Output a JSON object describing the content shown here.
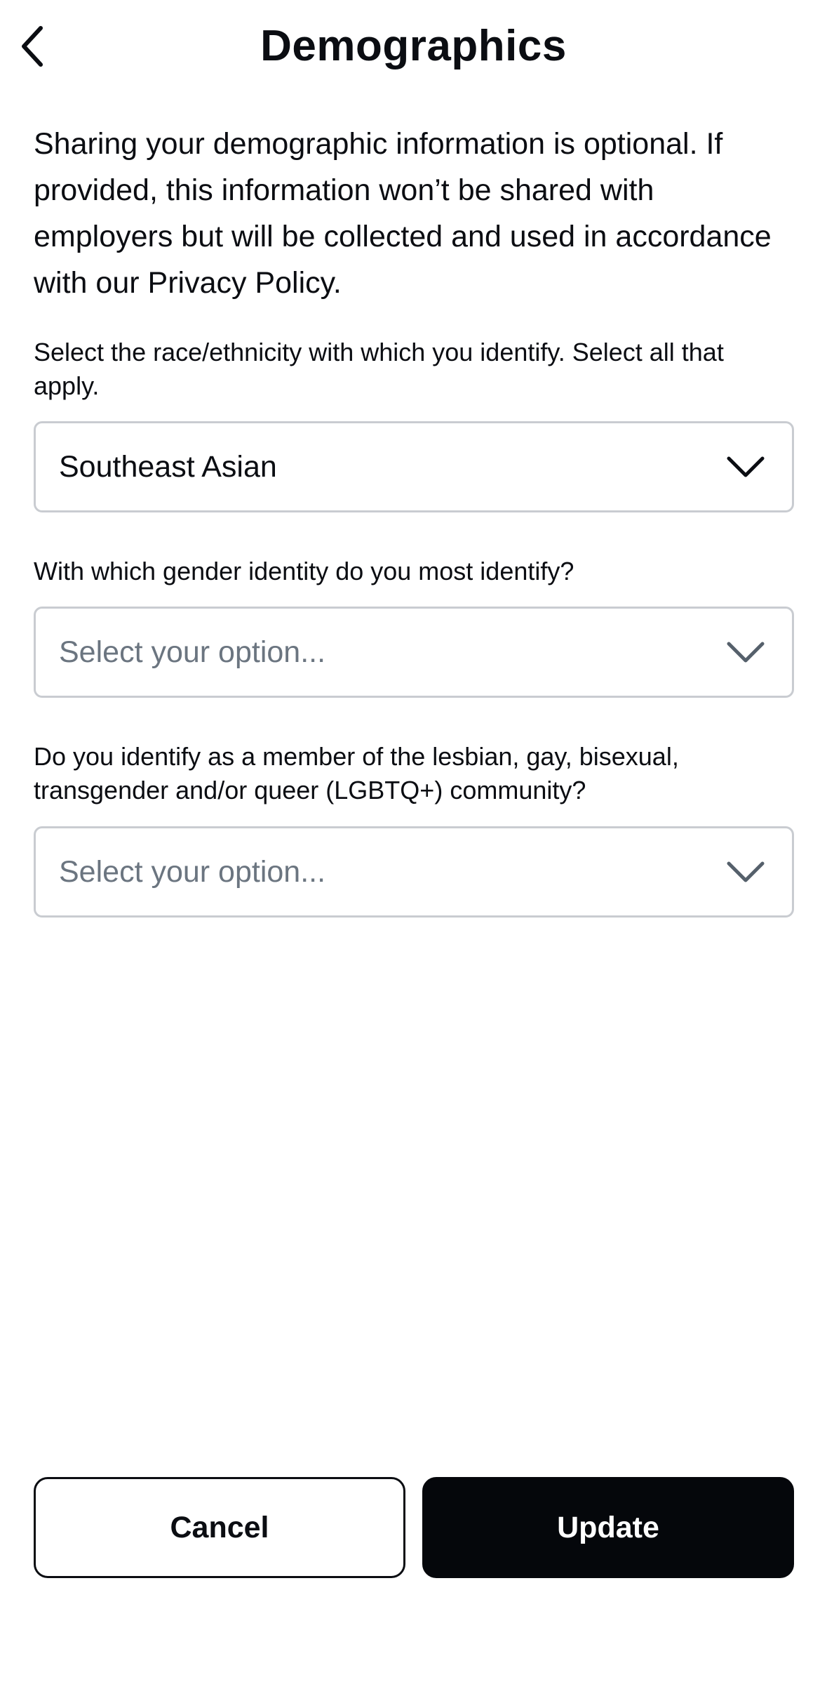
{
  "header": {
    "title": "Demographics",
    "back_icon": "chevron-left-icon"
  },
  "intro": {
    "text": "Sharing your demographic information is optional. If provided, this information won’t be shared with employers but will be collected and used in accordance with our Privacy Policy."
  },
  "questions": [
    {
      "label": "Select the race/ethnicity with which you identify. Select all that apply.",
      "value": "Southeast Asian",
      "is_placeholder": false
    },
    {
      "label": "With which gender identity do you most identify?",
      "value": "Select your option...",
      "is_placeholder": true
    },
    {
      "label": "Do you identify as a member of the lesbian, gay, bisexual, transgender and/or queer (LGBTQ+) community?",
      "value": "Select your option...",
      "is_placeholder": true
    }
  ],
  "actions": {
    "cancel_label": "Cancel",
    "update_label": "Update"
  },
  "colors": {
    "text": "#0b0d12",
    "placeholder": "#6b7580",
    "border": "#c9ccd1",
    "primary_button": "#05070b"
  }
}
